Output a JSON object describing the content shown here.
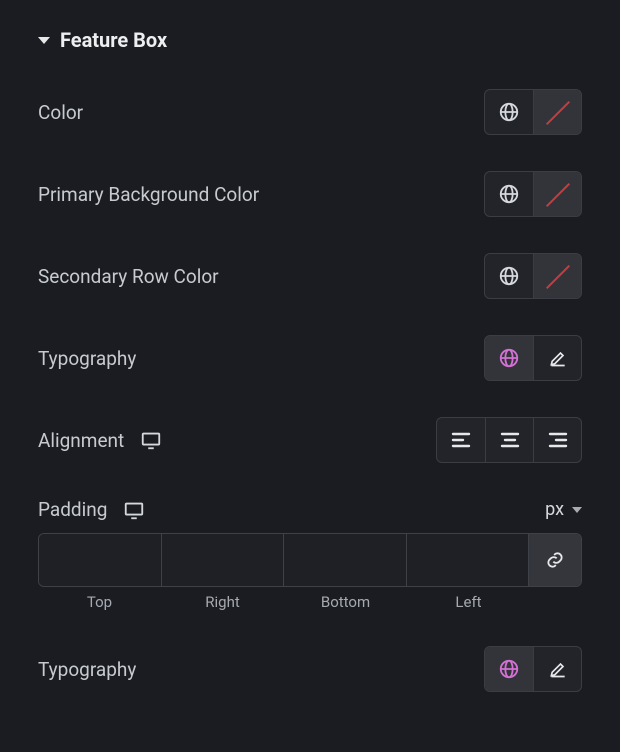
{
  "section": {
    "title": "Feature Box"
  },
  "rows": {
    "color": {
      "label": "Color"
    },
    "primary_bg": {
      "label": "Primary Background Color"
    },
    "secondary_row": {
      "label": "Secondary Row Color"
    },
    "typography1": {
      "label": "Typography"
    },
    "alignment": {
      "label": "Alignment"
    },
    "padding": {
      "label": "Padding",
      "unit": "px"
    },
    "typography2": {
      "label": "Typography"
    }
  },
  "padding_sides": {
    "top": "Top",
    "right": "Right",
    "bottom": "Bottom",
    "left": "Left"
  },
  "padding_values": {
    "top": "",
    "right": "",
    "bottom": "",
    "left": ""
  }
}
